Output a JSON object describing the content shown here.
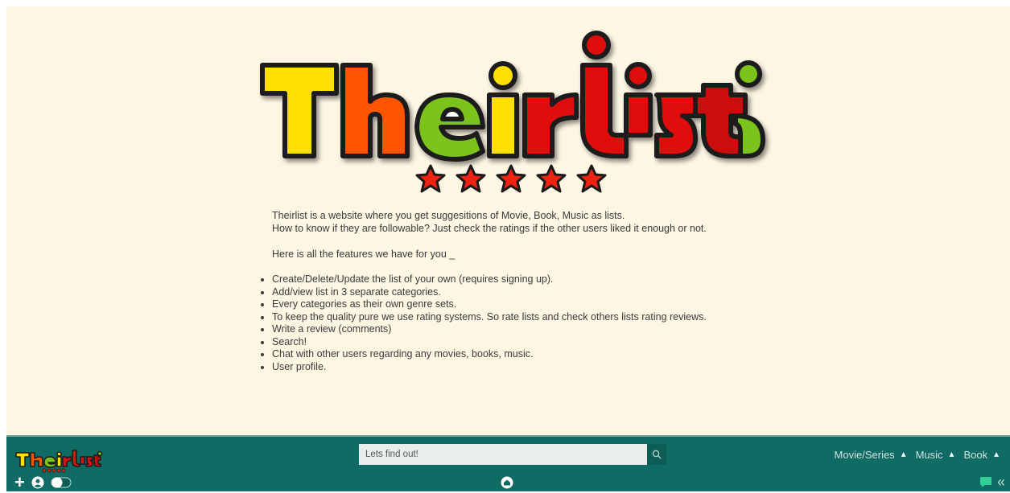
{
  "logo": {
    "text": "Theirlist"
  },
  "intro": {
    "line1": "Theirlist is a website where you get suggesitions of Movie, Book, Music as lists.",
    "line2": "How to know if they are followable? Just check the ratings if the other users liked it enough or not.",
    "features_intro": "Here is all the features we have for you _"
  },
  "features": [
    "Create/Delete/Update the list of your own (requires signing up).",
    "Add/view list in 3 separate categories.",
    "Every categories as their own genre sets.",
    "To keep the quality pure we use rating systems. So rate lists and check others lists rating reviews.",
    "Write a review (comments)",
    "Search!",
    "Chat with other users regarding any movies, books, music.",
    "User profile."
  ],
  "footer": {
    "search_placeholder": "Lets find out!",
    "nav": [
      "Movie/Series",
      "Music",
      "Book"
    ]
  },
  "colors": {
    "background": "#fdf6e3",
    "footer": "#0f6b63",
    "logo_yellow": "#ffe000",
    "logo_orange": "#ff5500",
    "logo_green": "#7cc41a",
    "logo_red": "#e01010",
    "star_red": "#ee2211"
  }
}
